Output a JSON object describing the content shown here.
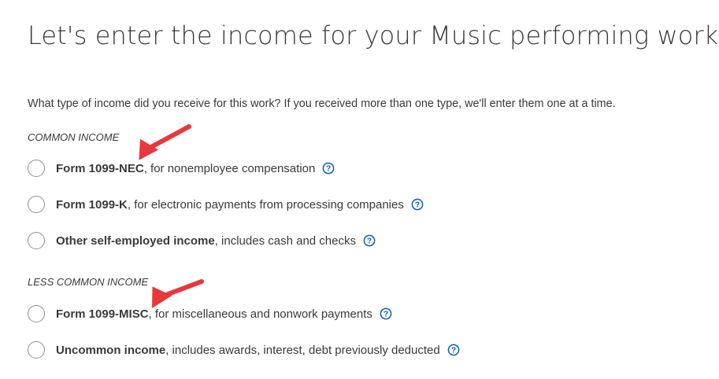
{
  "title": "Let's enter the income for your Music performing work",
  "question": "What type of income did you receive for this work? If you received more than one type, we'll enter them one at a time.",
  "colors": {
    "radio_border": "#8d9096",
    "help_icon": "#0d5eb8",
    "annotation_arrow": "#e8383d",
    "text": "#393a3d"
  },
  "sections": [
    {
      "heading": "COMMON INCOME",
      "options": [
        {
          "bold": "Form 1099-NEC",
          "rest": ", for nonemployee compensation",
          "selected": false,
          "icon": "help-icon"
        },
        {
          "bold": "Form 1099-K",
          "rest": ", for electronic payments from processing companies",
          "selected": false,
          "icon": "help-icon"
        },
        {
          "bold": "Other self-employed income",
          "rest": ", includes cash and checks",
          "selected": false,
          "icon": "help-icon"
        }
      ]
    },
    {
      "heading": "LESS COMMON INCOME",
      "options": [
        {
          "bold": "Form 1099-MISC",
          "rest": ", for miscellaneous and nonwork payments",
          "selected": false,
          "icon": "help-icon"
        },
        {
          "bold": "Uncommon income",
          "rest": ", includes awards, interest, debt previously deducted",
          "selected": false,
          "icon": "help-icon"
        }
      ]
    }
  ],
  "annotations": [
    {
      "type": "arrow-annotation",
      "points_to": "Form 1099-NEC"
    },
    {
      "type": "arrow-annotation",
      "points_to": "Form 1099-MISC"
    }
  ]
}
